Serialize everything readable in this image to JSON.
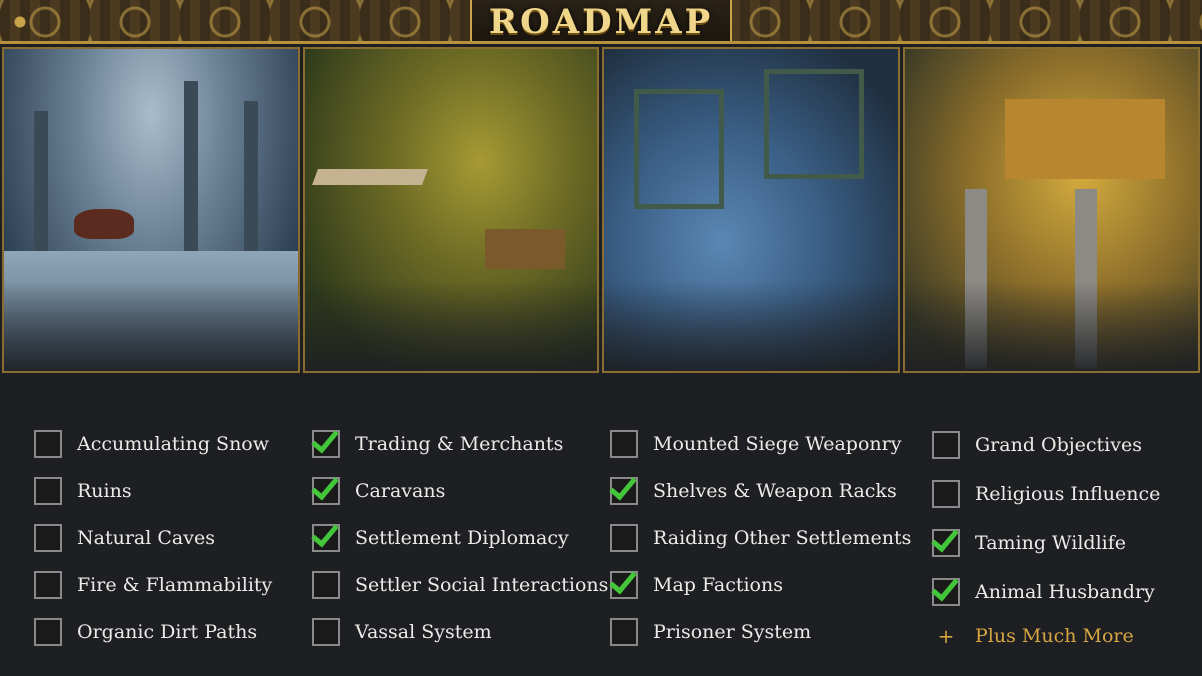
{
  "header": {
    "title": "ROADMAP"
  },
  "panels": [
    {
      "name": "winter-forest"
    },
    {
      "name": "settlement-market"
    },
    {
      "name": "siege-battle"
    },
    {
      "name": "wooden-towers"
    }
  ],
  "columns": [
    {
      "items": [
        {
          "label": "Accumulating Snow",
          "checked": false
        },
        {
          "label": "Ruins",
          "checked": false
        },
        {
          "label": "Natural Caves",
          "checked": false
        },
        {
          "label": "Fire & Flammability",
          "checked": false
        },
        {
          "label": "Organic Dirt Paths",
          "checked": false
        }
      ]
    },
    {
      "items": [
        {
          "label": "Trading & Merchants",
          "checked": true
        },
        {
          "label": "Caravans",
          "checked": true
        },
        {
          "label": "Settlement Diplomacy",
          "checked": true
        },
        {
          "label": "Settler Social Interactions",
          "checked": false
        },
        {
          "label": "Vassal System",
          "checked": false
        }
      ]
    },
    {
      "items": [
        {
          "label": "Mounted Siege Weaponry",
          "checked": false
        },
        {
          "label": "Shelves & Weapon Racks",
          "checked": true
        },
        {
          "label": "Raiding Other Settlements",
          "checked": false
        },
        {
          "label": "Map Factions",
          "checked": true
        },
        {
          "label": "Prisoner System",
          "checked": false
        }
      ]
    },
    {
      "items": [
        {
          "label": "Grand Objectives",
          "checked": false
        },
        {
          "label": "Religious Influence",
          "checked": false
        },
        {
          "label": "Taming Wildlife",
          "checked": true
        },
        {
          "label": "Animal Husbandry",
          "checked": true
        }
      ],
      "more": {
        "symbol": "+",
        "label": "Plus Much More"
      }
    }
  ],
  "colors": {
    "check": "#44c63a",
    "accent": "#d7a641",
    "gold": "#c9a44a"
  }
}
